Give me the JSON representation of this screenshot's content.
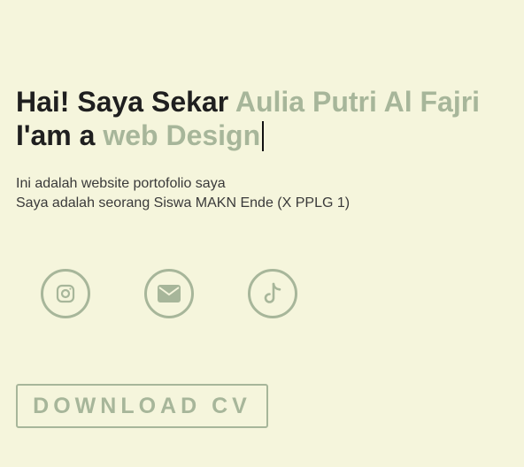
{
  "hero": {
    "greeting_prefix": "Hai! Saya Sekar ",
    "name_highlight": "Aulia Putri Al Fajri",
    "role_prefix": "I'am a ",
    "role_highlight": "web Design",
    "intro_line1": "Ini adalah website portofolio saya",
    "intro_line2": "Saya adalah seorang Siswa MAKN Ende (X PPLG 1)"
  },
  "socials": [
    {
      "icon": "instagram-icon"
    },
    {
      "icon": "envelope-icon"
    },
    {
      "icon": "tiktok-icon"
    }
  ],
  "cta": {
    "download_label": "DOWNLOAD CV"
  },
  "colors": {
    "background": "#f5f5dc",
    "accent": "#a7b69a",
    "text": "#1f1f1f"
  }
}
